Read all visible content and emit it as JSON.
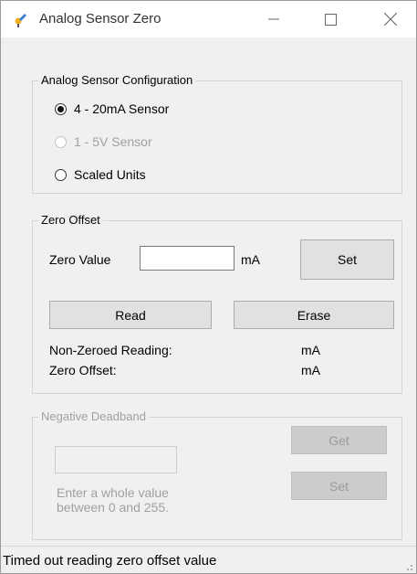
{
  "window": {
    "title": "Analog Sensor Zero"
  },
  "config_group": {
    "label": "Analog Sensor Configuration",
    "options": [
      {
        "label": "4 - 20mA Sensor",
        "checked": true,
        "enabled": true
      },
      {
        "label": "1 - 5V Sensor",
        "checked": false,
        "enabled": false
      },
      {
        "label": "Scaled Units",
        "checked": false,
        "enabled": true
      }
    ]
  },
  "zero_group": {
    "label": "Zero Offset",
    "zero_value_label": "Zero Value",
    "zero_value": "",
    "unit": "mA",
    "set_label": "Set",
    "read_label": "Read",
    "erase_label": "Erase",
    "non_zeroed_label": "Non-Zeroed Reading:",
    "non_zeroed_unit": "mA",
    "zero_offset_label": "Zero Offset:",
    "zero_offset_unit": "mA"
  },
  "deadband_group": {
    "label": "Negative Deadband",
    "value": "",
    "hint_line1": "Enter a whole value",
    "hint_line2": "between 0 and 255.",
    "get_label": "Get",
    "set_label": "Set"
  },
  "status": {
    "text": "Timed out reading zero offset value"
  },
  "colors": {
    "disabled_text": "#a0a0a0",
    "button_face": "#e1e1e1"
  }
}
